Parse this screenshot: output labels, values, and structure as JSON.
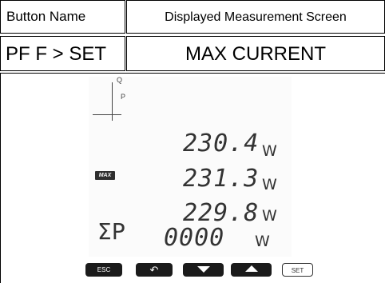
{
  "table": {
    "header": {
      "col1": "Button Name",
      "col2": "Displayed Measurement Screen"
    },
    "row": {
      "button": "PF F > SET",
      "screen": "MAX CURRENT"
    }
  },
  "lcd": {
    "axis_q": "Q",
    "axis_p": "P",
    "max_badge": "MAX",
    "sigma_label": "ΣP",
    "readings": [
      {
        "value": "230.4",
        "unit": "W"
      },
      {
        "value": "231.3",
        "unit": "W"
      },
      {
        "value": "229.8",
        "unit": "W"
      }
    ],
    "total": {
      "value": "0000",
      "unit": "W"
    }
  },
  "buttons": {
    "esc": "ESC",
    "back": "↶",
    "down": "down",
    "up": "up",
    "set": "SET"
  }
}
